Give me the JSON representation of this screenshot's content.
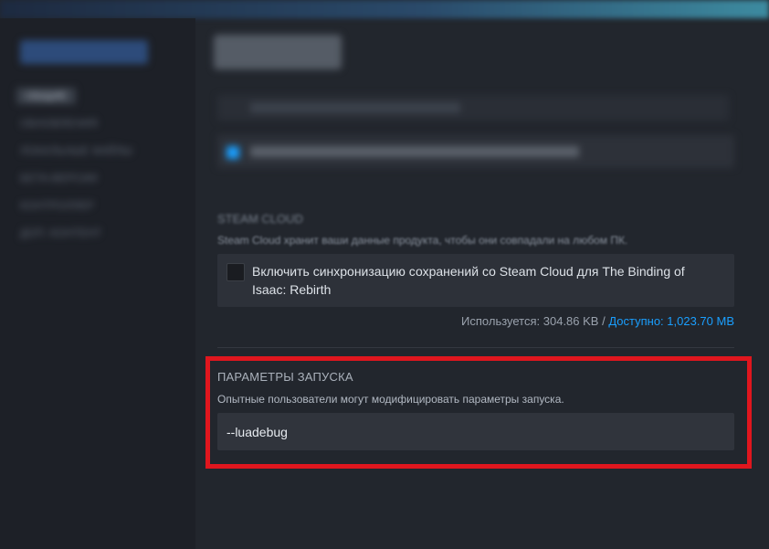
{
  "sidebar": {
    "items": [
      {
        "label": "ОБЩИЕ",
        "active": true
      },
      {
        "label": "ОБНОВЛЕНИЯ",
        "active": false
      },
      {
        "label": "ЛОКАЛЬНЫЕ ФАЙЛЫ",
        "active": false
      },
      {
        "label": "БЕТА-ВЕРСИИ",
        "active": false
      },
      {
        "label": "КОНТРОЛЛЕР",
        "active": false
      },
      {
        "label": "ДОП. КОНТЕНТ",
        "active": false
      }
    ]
  },
  "steam_cloud": {
    "title": "STEAM CLOUD",
    "description": "Steam Cloud хранит ваши данные продукта, чтобы они совпадали на любом ПК.",
    "checkbox_label": "Включить синхронизацию сохранений со Steam Cloud для The Binding of Isaac: Rebirth",
    "checked": false,
    "usage_prefix": "Используется: 304.86 KB /",
    "available": "Доступно: 1,023.70 MB"
  },
  "launch_options": {
    "title": "ПАРАМЕТРЫ ЗАПУСКА",
    "description": "Опытные пользователи могут модифицировать параметры запуска.",
    "value": "--luadebug"
  },
  "colors": {
    "accent": "#1a9fff",
    "highlight": "#e0161e",
    "background": "#22262d",
    "sidebar": "#1d2027"
  }
}
